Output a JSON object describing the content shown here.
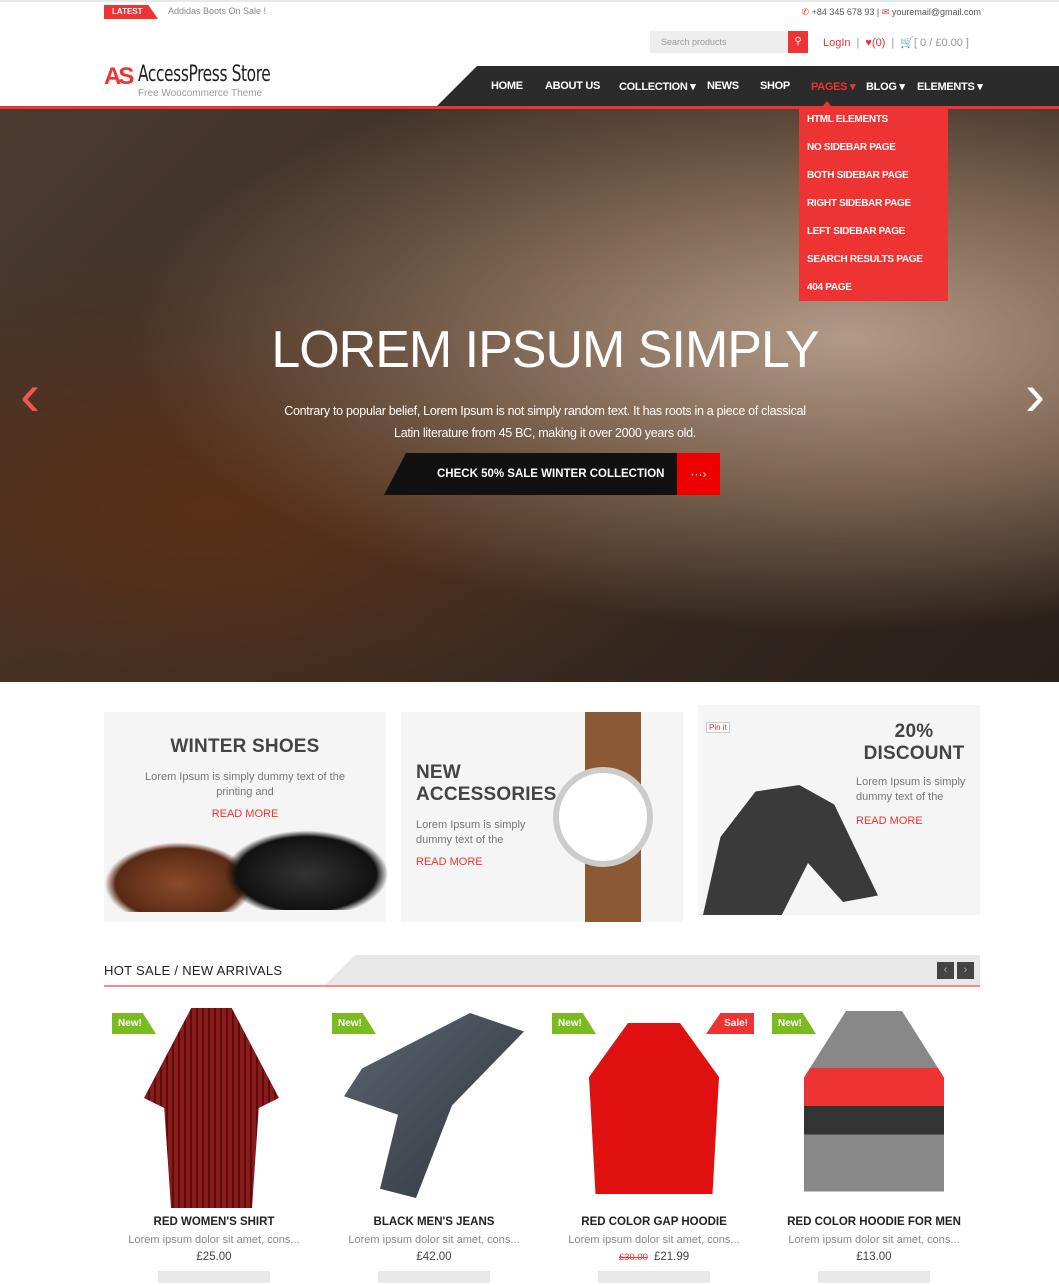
{
  "topbar": {
    "latest_label": "LATEST",
    "news": "Addidas Boots On Sale !",
    "phone": "+84 345 678 93",
    "email": "youremail@gmail.com"
  },
  "header": {
    "search_placeholder": "Search products",
    "login": "LogIn",
    "wishlist": "(0)",
    "cart": "[ 0 / £0.00 ]",
    "logo_mark_a": "A",
    "logo_mark_s": "S",
    "logo_name": "AccessPress Store",
    "logo_tagline": "Free Woocommerce Theme"
  },
  "nav": {
    "items": [
      "HOME",
      "ABOUT US",
      "COLLECTION",
      "NEWS",
      "SHOP",
      "PAGES",
      "BLOG",
      "ELEMENTS"
    ],
    "active": "PAGES",
    "dropdown": [
      "HTML ELEMENTS",
      "NO SIDEBAR PAGE",
      "BOTH SIDEBAR PAGE",
      "RIGHT SIDEBAR PAGE",
      "LEFT SIDEBAR PAGE",
      "SEARCH RESULTS PAGE",
      "404 PAGE"
    ]
  },
  "hero": {
    "title": "LOREM IPSUM SIMPLY",
    "text": "Contrary to popular belief, Lorem Ipsum is not simply random text. It has roots in a piece of classical Latin literature from 45 BC, making it over 2000 years old.",
    "button": "CHECK 50% SALE WINTER COLLECTION"
  },
  "promos": [
    {
      "title": "WINTER SHOES",
      "text": "Lorem Ipsum is simply dummy text of the printing and",
      "link": "READ MORE"
    },
    {
      "title": "NEW ACCESSORIES",
      "text": "Lorem Ipsum is simply dummy text of the",
      "link": "READ MORE"
    },
    {
      "title": "20% DISCOUNT",
      "text": "Lorem Ipsum is simply dummy text of the",
      "link": "READ MORE",
      "pin": "Pin it"
    }
  ],
  "section": {
    "title": "HOT SALE / NEW ARRIVALS"
  },
  "products": [
    {
      "badge": "New!",
      "name": "RED WOMEN'S SHIRT",
      "desc": "Lorem ipsum dolor sit amet, cons...",
      "price": "£25.00"
    },
    {
      "badge": "New!",
      "name": "BLACK MEN'S JEANS",
      "desc": "Lorem ipsum dolor sit amet, cons...",
      "price": "£42.00"
    },
    {
      "badge": "New!",
      "sale_badge": "Sale!",
      "name": "RED COLOR GAP HOODIE",
      "desc": "Lorem ipsum dolor sit amet, cons...",
      "old_price": "£30.00",
      "price": "£21.99"
    },
    {
      "badge": "New!",
      "name": "RED COLOR HOODIE FOR MEN",
      "desc": "Lorem ipsum dolor sit amet, cons...",
      "price": "£13.00"
    }
  ],
  "colors": {
    "accent": "#ee3333",
    "nav_bg": "#2b2b2b",
    "new_badge": "#7cbb1f"
  }
}
